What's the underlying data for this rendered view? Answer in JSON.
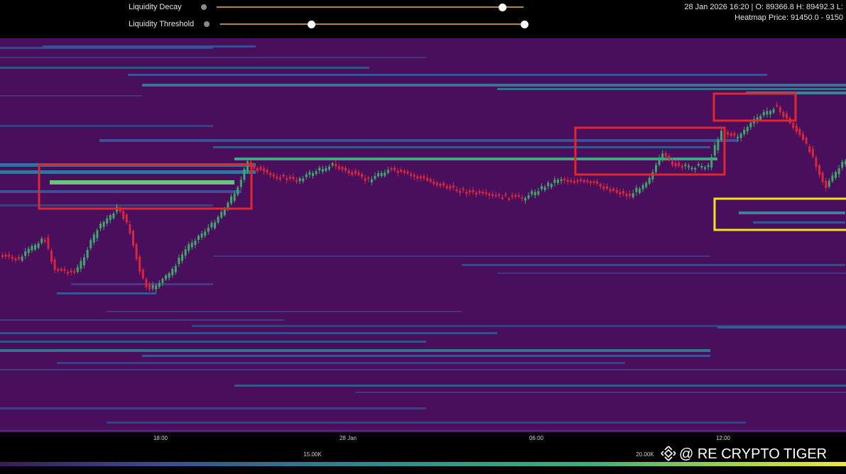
{
  "controls": {
    "decay": {
      "label": "Liquidity Decay",
      "value": 0.93
    },
    "threshold": {
      "label": "Liquidity Threshold",
      "low": 0.3,
      "high": 1.0
    }
  },
  "info": {
    "ohlc_line": "28 Jan 2026 16:20 | O: 89366.8 H: 89492.3 L:",
    "heatmap_line": "Heatmap Price: 91450.0 - 9150"
  },
  "xaxis": {
    "ticks": [
      "18:00",
      "28 Jan",
      "06:00",
      "12:00"
    ]
  },
  "colorscale": {
    "ticks": [
      "15.00K",
      "20.00K"
    ]
  },
  "watermark": "@ RE CRYPTO TIGER",
  "colors": {
    "background": "#4a0f5c",
    "candle_up": "#3ea86a",
    "candle_down": "#d7263d",
    "highlight_red": "#e0262e",
    "highlight_yellow": "#f2e21c",
    "slider_track": "#b8803a"
  },
  "icons": [
    "help-icon",
    "binance-logo-icon"
  ]
}
